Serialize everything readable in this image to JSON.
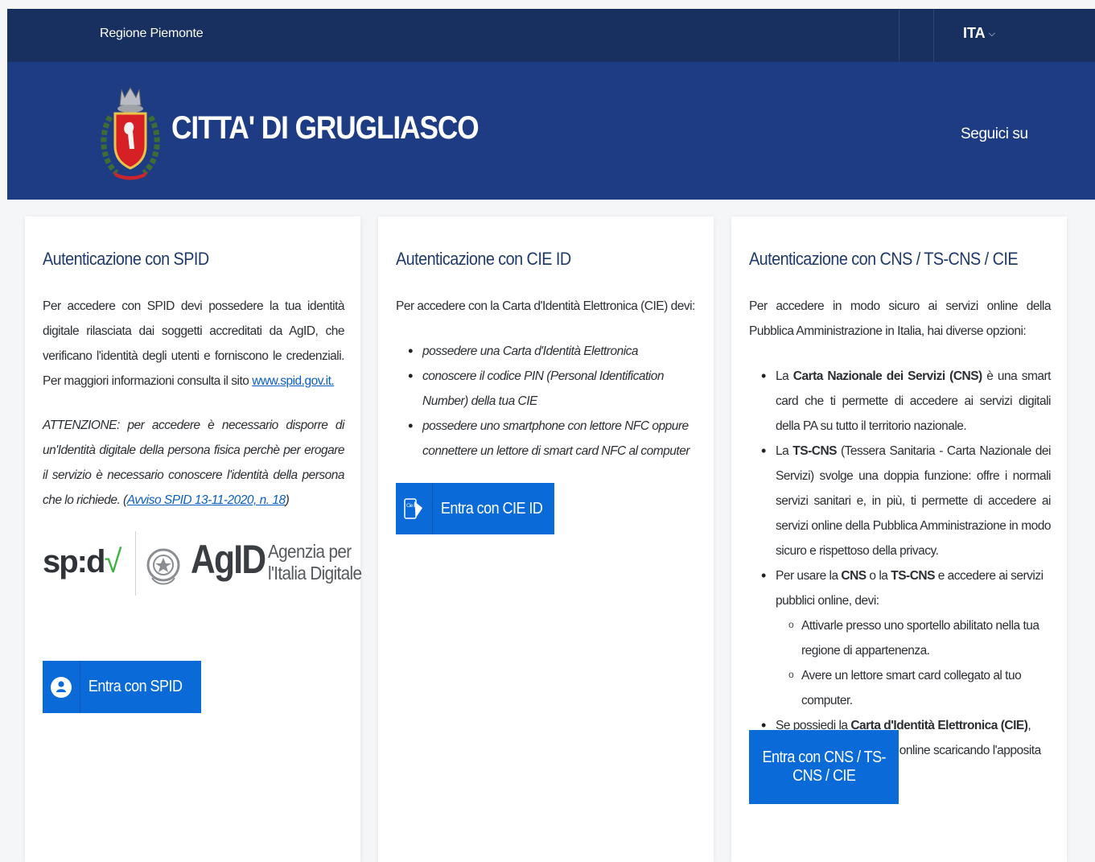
{
  "topbar": {
    "region": "Regione Piemonte",
    "language": "ITA"
  },
  "header": {
    "title": "CITTA' DI GRUGLIASCO",
    "follow": "Seguici su"
  },
  "spid": {
    "title": "Autenticazione con SPID",
    "intro": "Per accedere con SPID devi possedere la tua identità digitale rilasciata dai soggetti accreditati da AgID, che verificano l'identità degli utenti e forniscono le credenziali. Per maggiori informazioni consulta il sito ",
    "link": "www.spid.gov.it.",
    "warning": "ATTENZIONE: per accedere è necessario disporre di un'Identità digitale della persona fisica perchè per erogare il servizio è necessario conoscere l'identità della persona che lo richiede. (",
    "warning_link": "Avviso SPID 13-11-2020, n. 18",
    "warning_end": ")",
    "logo_spid": "sp:d",
    "logo_agid": "AgID",
    "logo_agid_sub1": "Agenzia per",
    "logo_agid_sub2": "l'Italia Digitale",
    "button": "Entra con SPID"
  },
  "cie": {
    "title": "Autenticazione con CIE ID",
    "intro": "Per accedere con la Carta d'Identità Elettronica (CIE) devi:",
    "items": [
      "possedere una Carta d'Identità Elettronica",
      "conoscere il codice PIN (Personal Identification Number) della tua CIE",
      "possedere uno smartphone con lettore NFC oppure connettere un lettore di smart card NFC al computer"
    ],
    "icon_text": "Cie ID",
    "button": "Entra con CIE ID"
  },
  "cns": {
    "title": "Autenticazione con CNS / TS-CNS / CIE",
    "intro": "Per accedere in modo sicuro ai servizi online della Pubblica Amministrazione in Italia, hai diverse opzioni:",
    "b1_pre": "La ",
    "b1_bold": "Carta Nazionale dei Servizi (CNS)",
    "b1_post": " è una smart card che ti permette di accedere ai servizi digitali della PA su tutto il territorio nazionale.",
    "b2_pre": "La ",
    "b2_bold": "TS-CNS",
    "b2_post": " (Tessera Sanitaria - Carta Nazionale dei Servizi) svolge una doppia funzione: offre i normali servizi sanitari e, in più, ti permette di accedere ai servizi online della Pubblica Amministrazione in modo sicuro e rispettoso della privacy.",
    "b3_pre": "Per usare la ",
    "b3_bold1": "CNS",
    "b3_mid": " o la ",
    "b3_bold2": "TS-CNS",
    "b3_post": " e accedere ai servizi pubblici online, devi:",
    "sub1": "Attivarle presso uno sportello abilitato nella tua regione di appartenenza.",
    "sub2": "Avere un lettore smart card collegato al tuo computer.",
    "b4_pre": "Se possiedi la ",
    "b4_bold": "Carta d'Identità Elettronica (CIE)",
    "b4_post": ", puoi accedere ai servizi online scaricando l'apposita applicazione.",
    "button_line1": "Entra con CNS / TS-",
    "button_line2": "CNS / CIE"
  }
}
